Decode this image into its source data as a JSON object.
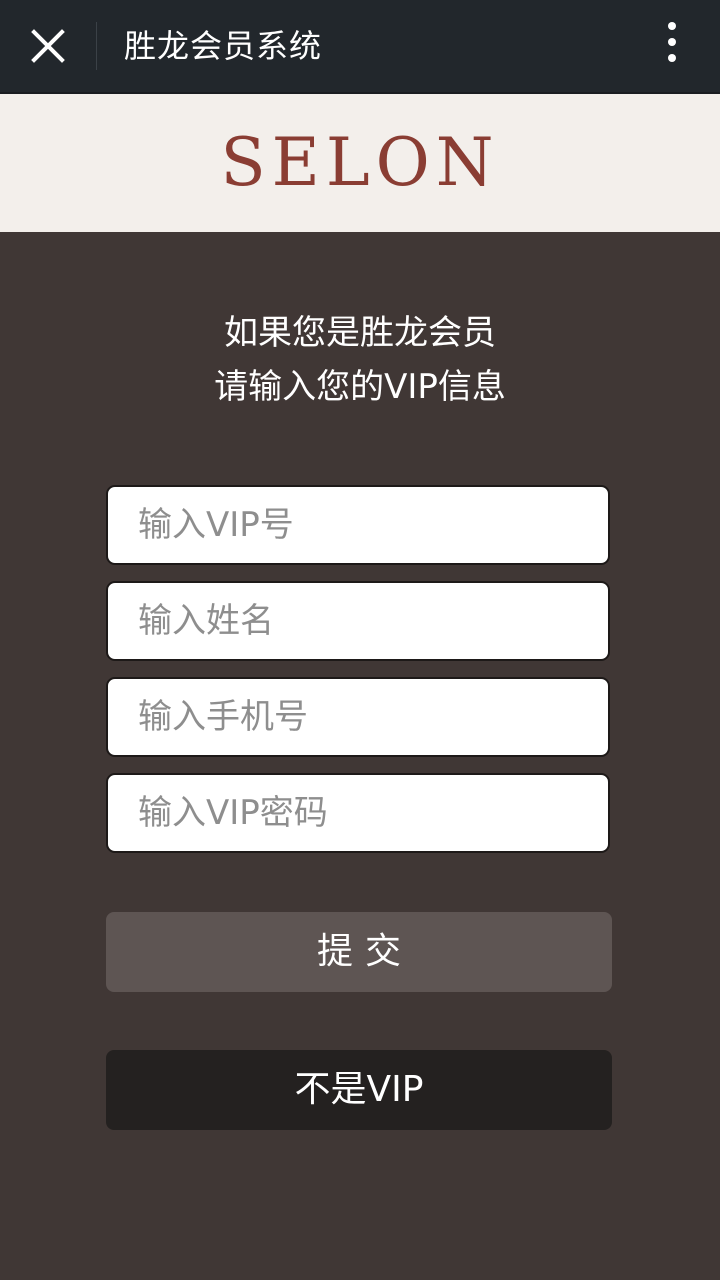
{
  "header": {
    "title": "胜龙会员系统",
    "close_icon": "close-icon",
    "more_icon": "more-vertical-icon"
  },
  "brand": {
    "logo_text": "SELON",
    "logo_color": "#8a3d33"
  },
  "intro": {
    "line1": "如果您是胜龙会员",
    "line2": "请输入您的VIP信息"
  },
  "form": {
    "vip_number": {
      "placeholder": "输入VIP号",
      "value": ""
    },
    "name": {
      "placeholder": "输入姓名",
      "value": ""
    },
    "phone": {
      "placeholder": "输入手机号",
      "value": ""
    },
    "password": {
      "placeholder": "输入VIP密码",
      "value": ""
    }
  },
  "actions": {
    "submit_label": "提交",
    "not_vip_label": "不是VIP"
  },
  "colors": {
    "background": "#403735",
    "topbar": "#22272c",
    "brand_band": "#f3efeb",
    "submit_button": "#5e5553",
    "not_vip_button": "#242120"
  }
}
